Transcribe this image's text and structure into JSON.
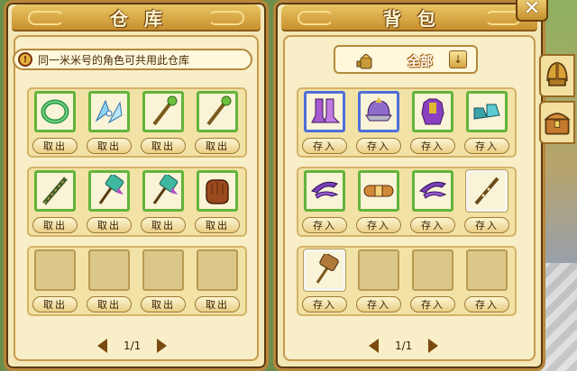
{
  "warehouse": {
    "title": "仓库",
    "notice": "同一米米号的角色可共用此仓库",
    "take_label": "取出",
    "items": [
      {
        "icon": "jade-bracelet-icon",
        "kind": "bracelet",
        "filled": true
      },
      {
        "icon": "wings-icon",
        "kind": "wings",
        "filled": true
      },
      {
        "icon": "staff-icon",
        "kind": "staff",
        "filled": true
      },
      {
        "icon": "staff-2-icon",
        "kind": "staff",
        "filled": true
      },
      {
        "icon": "rod-icon",
        "kind": "rod",
        "filled": true
      },
      {
        "icon": "hammer-icon",
        "kind": "hammer",
        "filled": true
      },
      {
        "icon": "hammer-2-icon",
        "kind": "hammer",
        "filled": true
      },
      {
        "icon": "gloves-icon",
        "kind": "gloves",
        "filled": true
      },
      {
        "filled": false
      },
      {
        "filled": false
      },
      {
        "filled": false
      },
      {
        "filled": false
      }
    ],
    "page": "1/1"
  },
  "backpack": {
    "title": "背包",
    "filter_label": "全部",
    "store_label": "存入",
    "items": [
      {
        "icon": "purple-boots-icon",
        "kind": "boots",
        "filled": true,
        "border": "blue"
      },
      {
        "icon": "purple-helmet-icon",
        "kind": "helmet",
        "filled": true,
        "border": "blue"
      },
      {
        "icon": "purple-armor-icon",
        "kind": "armor",
        "filled": true,
        "border": "green"
      },
      {
        "icon": "teal-shoes-icon",
        "kind": "shoes",
        "filled": true,
        "border": "green"
      },
      {
        "icon": "claw-icon",
        "kind": "claw",
        "filled": true,
        "border": "green"
      },
      {
        "icon": "belt-icon",
        "kind": "belt",
        "filled": true,
        "border": "green"
      },
      {
        "icon": "claw-2-icon",
        "kind": "claw",
        "filled": true,
        "border": "green"
      },
      {
        "icon": "flute-icon",
        "kind": "flute",
        "filled": true,
        "border": "white"
      },
      {
        "icon": "wood-hammer-icon",
        "kind": "woodhammer",
        "filled": true,
        "border": "white"
      },
      {
        "filled": false
      },
      {
        "filled": false
      },
      {
        "filled": false
      }
    ],
    "page": "1/1"
  },
  "colors": {
    "frame": "#b8863a",
    "parchment": "#f3e7b7",
    "green_border": "#62b43a",
    "blue_border": "#4f6fd9"
  }
}
